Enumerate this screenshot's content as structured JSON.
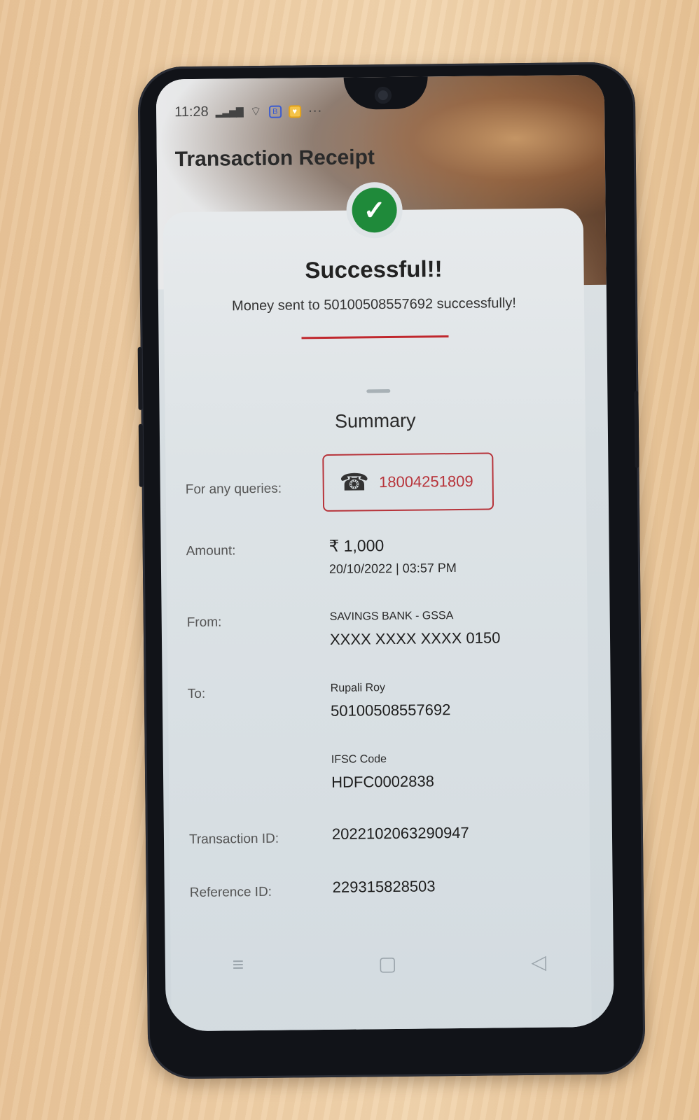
{
  "status_bar": {
    "time": "11:28",
    "signal": "▂▃▅▇",
    "wifi": "wifi-icon",
    "more": "···"
  },
  "header": {
    "title": "Transaction Receipt"
  },
  "result": {
    "title": "Successful!!",
    "message": "Money sent to 50100508557692 successfully!"
  },
  "summary": {
    "title": "Summary",
    "queries": {
      "label": "For any queries:",
      "phone": "18004251809"
    },
    "amount": {
      "label": "Amount:",
      "value": "₹ 1,000",
      "datetime": "20/10/2022 | 03:57 PM"
    },
    "from": {
      "label": "From:",
      "account_type": "SAVINGS BANK - GSSA",
      "account_number": "XXXX XXXX XXXX 0150"
    },
    "to": {
      "label": "To:",
      "name": "Rupali Roy",
      "account_number": "50100508557692",
      "ifsc_label": "IFSC Code",
      "ifsc": "HDFC0002838"
    },
    "transaction": {
      "label": "Transaction ID:",
      "value": "202210206329094​7"
    },
    "reference": {
      "label": "Reference ID:",
      "value": "229315828503"
    }
  },
  "colors": {
    "accent_red": "#b7333a",
    "success_green": "#1f8a3a"
  }
}
